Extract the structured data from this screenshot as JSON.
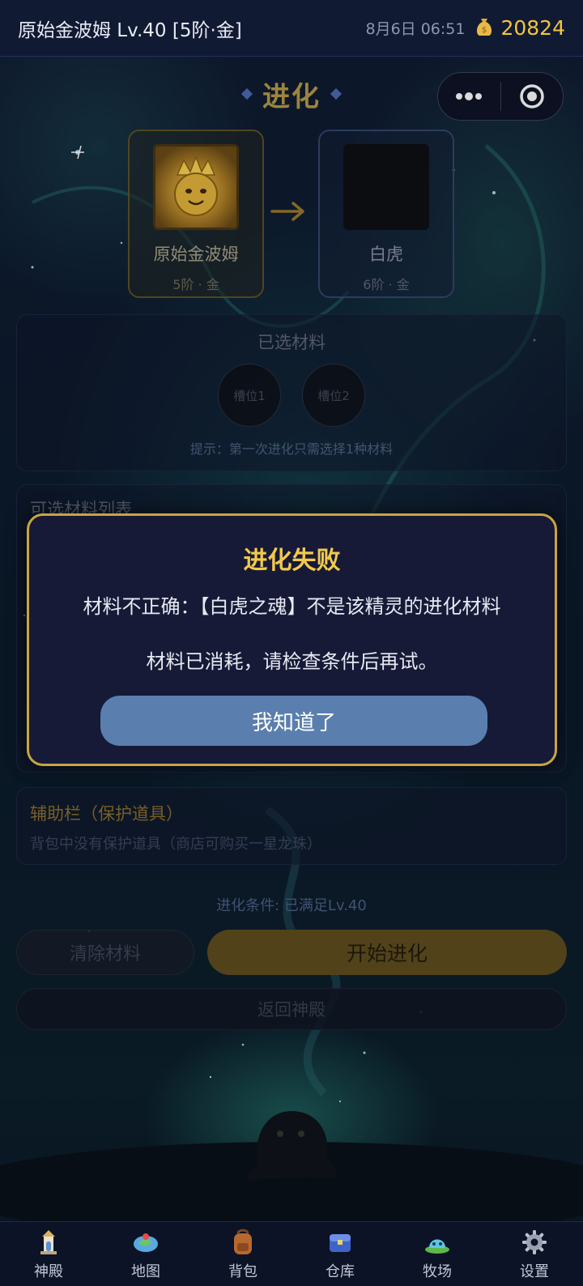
{
  "status_bar": {
    "pet_info": "原始金波姆 Lv.40 [5阶·金]",
    "datetime": "8月6日 06:51",
    "coins": "20824"
  },
  "header": {
    "title": "进化"
  },
  "evolution": {
    "from": {
      "name": "原始金波姆",
      "rank": "5阶 · 金"
    },
    "to": {
      "name": "白虎",
      "rank": "6阶 · 金"
    }
  },
  "selected_materials": {
    "title": "已选材料",
    "slots": [
      "槽位1",
      "槽位2"
    ],
    "hint": "提示：第一次进化只需选择1种材料"
  },
  "available_materials": {
    "title": "可选材料列表"
  },
  "auxiliary": {
    "title": "辅助栏（保护道具）",
    "description": "背包中没有保护道具（商店可购买一星龙珠）"
  },
  "condition_text": "进化条件: 已满足Lv.40",
  "buttons": {
    "clear": "清除材料",
    "start": "开始进化",
    "back": "返回神殿"
  },
  "modal": {
    "title": "进化失败",
    "message": "材料不正确：【白虎之魂】不是该精灵的进化材料",
    "sub_message": "材料已消耗，请检查条件后再试。",
    "confirm": "我知道了"
  },
  "bottom_nav": [
    {
      "label": "神殿",
      "icon": "temple-icon"
    },
    {
      "label": "地图",
      "icon": "map-icon"
    },
    {
      "label": "背包",
      "icon": "backpack-icon"
    },
    {
      "label": "仓库",
      "icon": "warehouse-icon"
    },
    {
      "label": "牧场",
      "icon": "ranch-icon"
    },
    {
      "label": "设置",
      "icon": "gear-icon"
    }
  ],
  "colors": {
    "accent_gold": "#f2c94c",
    "modal_button": "#5a7fae",
    "coin": "#f0c541"
  }
}
